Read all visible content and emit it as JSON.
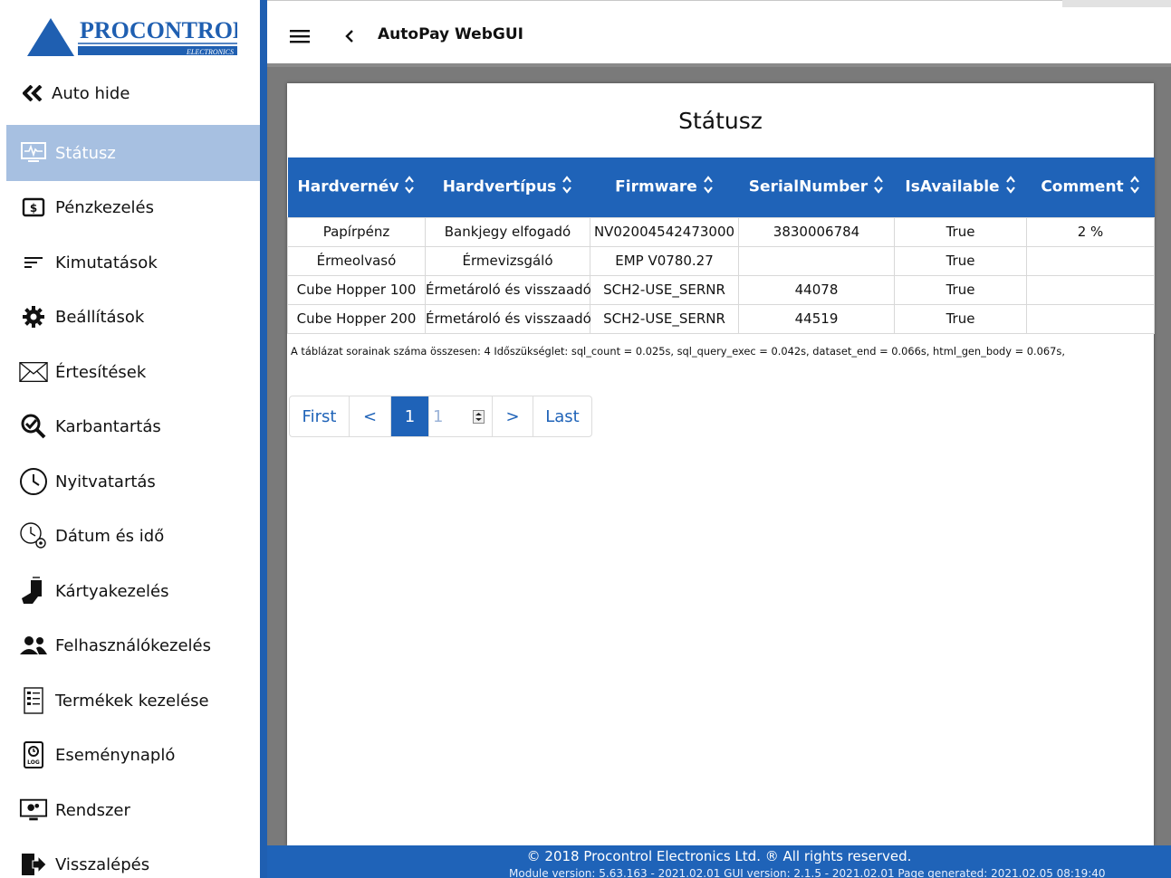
{
  "logo": {
    "name": "PROCONTROL",
    "sub": "ELECTRONICS"
  },
  "sidebar": {
    "autohide_label": "Auto hide",
    "items": [
      {
        "label": "Státusz",
        "icon": "monitor-pulse-icon"
      },
      {
        "label": "Pénzkezelés",
        "icon": "money-icon"
      },
      {
        "label": "Kimutatások",
        "icon": "lines-icon"
      },
      {
        "label": "Beállítások",
        "icon": "gear-icon"
      },
      {
        "label": "Értesítések",
        "icon": "envelope-icon"
      },
      {
        "label": "Karbantartás",
        "icon": "maintenance-icon"
      },
      {
        "label": "Nyitvatartás",
        "icon": "clock-icon"
      },
      {
        "label": "Dátum és idő",
        "icon": "clock-gear-icon"
      },
      {
        "label": "Kártyakezelés",
        "icon": "card-icon"
      },
      {
        "label": "Felhasználókezelés",
        "icon": "users-icon"
      },
      {
        "label": "Termékek kezelése",
        "icon": "product-list-icon"
      },
      {
        "label": "Eseménynapló",
        "icon": "log-icon"
      },
      {
        "label": "Rendszer",
        "icon": "system-icon"
      },
      {
        "label": "Visszalépés",
        "icon": "logout-icon"
      }
    ]
  },
  "header": {
    "title": "AutoPay WebGUI"
  },
  "main": {
    "title": "Státusz",
    "table": {
      "columns": [
        "Hardvernév",
        "Hardvertípus",
        "Firmware",
        "SerialNumber",
        "IsAvailable",
        "Comment"
      ],
      "rows": [
        [
          "Papírpénz",
          "Bankjegy elfogadó",
          "NV02004542473000",
          "3830006784",
          "True",
          "2 %"
        ],
        [
          "Érmeolvasó",
          "Érmevizsgáló",
          "EMP V0780.27",
          "",
          "True",
          ""
        ],
        [
          "Cube Hopper 100",
          "Érmetároló és visszaadó",
          "SCH2-USE_SERNR",
          "44078",
          "True",
          ""
        ],
        [
          "Cube Hopper 200",
          "Érmetároló és visszaadó",
          "SCH2-USE_SERNR",
          "44519",
          "True",
          ""
        ]
      ]
    },
    "summary": "A táblázat sorainak száma összesen: 4   Időszükséglet: sql_count = 0.025s, sql_query_exec = 0.042s, dataset_end = 0.066s, html_gen_body = 0.067s,",
    "pager": {
      "first": "First",
      "prev": "<",
      "current": "1",
      "input_value": "1",
      "next": ">",
      "last": "Last"
    }
  },
  "footer": {
    "copyright": "© 2018 Procontrol Electronics Ltd. ® All rights reserved.",
    "version": "Module version: 5.63.163 - 2021.02.01     GUI version: 2.1.5 - 2021.02.01     Page generated: 2021.02.05 08:19:40"
  },
  "colors": {
    "accent": "#1f63b8",
    "active_nav": "#a7c0e1",
    "sidebar_bar": "#1f5fb1"
  }
}
